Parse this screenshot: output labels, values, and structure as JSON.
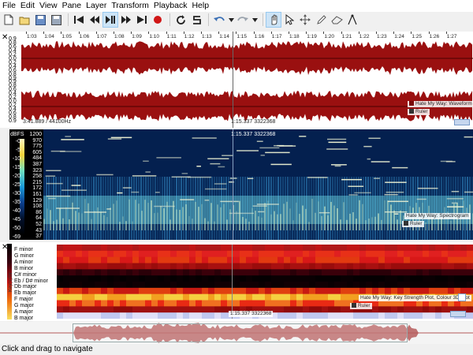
{
  "menu": [
    "File",
    "Edit",
    "View",
    "Pane",
    "Layer",
    "Transform",
    "Playback",
    "Help"
  ],
  "toolbar_icons": [
    "new-file-icon",
    "open-folder-icon",
    "save-icon",
    "save-as-icon",
    "rewind-start-icon",
    "rewind-icon",
    "play-pause-icon",
    "fast-forward-icon",
    "fast-forward-end-icon",
    "record-icon",
    "loop-icon",
    "solo-icon",
    "undo-icon",
    "undo-dropdown-icon",
    "redo-icon",
    "redo-dropdown-icon",
    "navigate-icon",
    "select-icon",
    "move-icon",
    "draw-icon",
    "erase-icon",
    "measure-icon"
  ],
  "ruler_ticks": [
    "1:03",
    "1:04",
    "1:05",
    "1:06",
    "1:07",
    "1:08",
    "1:09",
    "1:10",
    "1:11",
    "1:12",
    "1:13",
    "1:14",
    "1:15",
    "1:16",
    "1:17",
    "1:18",
    "1:19",
    "1:20",
    "1:21",
    "1:22",
    "1:23",
    "1:24",
    "1:25",
    "1:26",
    "1:27"
  ],
  "waveform": {
    "scale": [
      "0.9",
      "0.8",
      "0.6",
      "0.4",
      "0.2",
      "0.0",
      "0.2",
      "0.4",
      "0.6",
      "0.8",
      "0.9",
      "0.9",
      "0.8",
      "0.6",
      "0.4",
      "0.2",
      "0.0",
      "0.2",
      "0.4",
      "0.6",
      "0.8",
      "0.9"
    ],
    "duration": "3:41.889 / 44100Hz",
    "cursor": "1:15.337  3322368",
    "layer_label": "Hate My Way: Waveform",
    "ruler_label": "Ruler",
    "color": "#9a1010"
  },
  "spectrogram": {
    "unit": "dBFS",
    "db_scale": [
      "-0",
      "-5",
      "-10",
      "-15",
      "-20",
      "-25",
      "-30",
      "-35",
      "-40",
      "-45",
      "-50",
      "-69"
    ],
    "freq_scale": [
      "1200",
      "970",
      "775",
      "605",
      "484",
      "387",
      "323",
      "258",
      "215",
      "172",
      "161",
      "129",
      "108",
      "86",
      "64",
      "52",
      "43",
      "37"
    ],
    "cursor": "1:15.337  3322368",
    "layer_label": "Hate My Way: Spectrogram",
    "ruler_label": "Ruler"
  },
  "keystrength": {
    "side_label": "Key(s)Str",
    "keys": [
      "F minor",
      "G minor",
      "A minor",
      "B minor",
      "C# minor",
      "Eb / D# minor",
      "Db major",
      "Eb major",
      "F major",
      "G major",
      "A major",
      "B major"
    ],
    "cursor": "1:15.337  3322368",
    "layer_label": "Hate My Way: Key Strength Plot, Colour 3D Plot",
    "ruler_label": "Ruler"
  },
  "status": "Click and drag to navigate"
}
